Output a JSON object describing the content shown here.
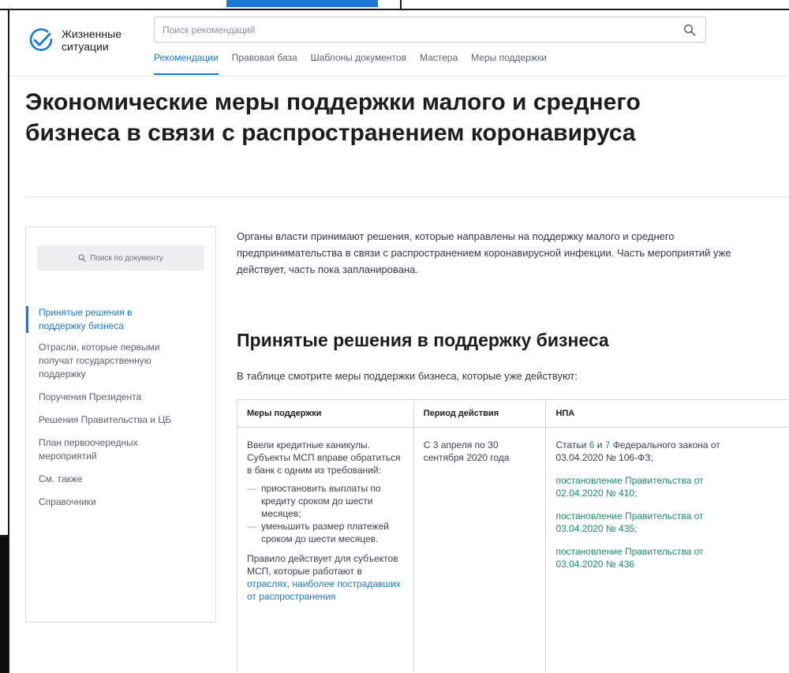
{
  "colors": {
    "accent": "#1c78d6",
    "link_green": "#1f8a6f",
    "frame_blue": "#1c78d6"
  },
  "logo": {
    "line1": "Жизненные",
    "line2": "ситуации",
    "icon": "checkmark-circle-icon"
  },
  "search": {
    "placeholder": "Поиск рекомендаций",
    "icon": "search-icon"
  },
  "nav": {
    "items": [
      "Рекомендации",
      "Правовая база",
      "Шаблоны документов",
      "Мастера",
      "Меры поддержки"
    ],
    "active": 0
  },
  "page": {
    "title": "Экономические меры поддержки малого и среднего бизнеса в связи с распространением коронавируса"
  },
  "sidebar": {
    "search_label": "Поиск по документу",
    "items": [
      {
        "label": "Принятые решения в поддержку бизнеса",
        "active": true
      },
      {
        "label": "Отрасли, которые первыми получат государственную поддержку",
        "active": false
      },
      {
        "label": "Поручения Президента",
        "active": false
      },
      {
        "label": "Решения Правительства и ЦБ",
        "active": false
      },
      {
        "label": "План первоочередных мероприятий",
        "active": false
      },
      {
        "label": "См. также",
        "active": false
      },
      {
        "label": "Справочники",
        "active": false
      }
    ]
  },
  "content": {
    "intro": "Органы власти принимают решения, которые направлены на поддержку малого и среднего предпринимательства в связи с распространением коронавирусной инфекции. Часть мероприятий уже действует, часть пока запланирована.",
    "section_title": "Принятые решения в поддержку бизнеса",
    "table_caption": "В таблице смотрите меры поддержки бизнеса, которые уже действуют:"
  },
  "table": {
    "headers": [
      "Меры поддержки",
      "Период действия",
      "НПА"
    ],
    "row1": {
      "measure_intro": "Ввели кредитные каникулы. Субъекты МСП вправе обратиться в банк с одним из требований:",
      "measure_items": [
        "приостановить выплаты по кредиту сроком до шести месяцев;",
        "уменьшить размер платежей сроком до шести месяцев."
      ],
      "measure_rule_prefix": "Правило действует для субъектов МСП, которые работают в",
      "measure_rule_link": "отраслях, наиболее пострадавших от распространения",
      "period": "С 3 апреля по 30 сентября 2020 года",
      "npa_law_prefix": "Статьи",
      "npa_law_link1": "6",
      "npa_law_mid": "и",
      "npa_law_link2": "7",
      "npa_law_suffix": "Федерального закона от 03.04.2020 № 106-ФЗ;",
      "npa_links": [
        "постановление Правительства от 02.04.2020 № 410;",
        "постановление Правительства от 03.04.2020 № 435;",
        "постановление Правительства от 03.04.2020 № 436"
      ]
    }
  }
}
